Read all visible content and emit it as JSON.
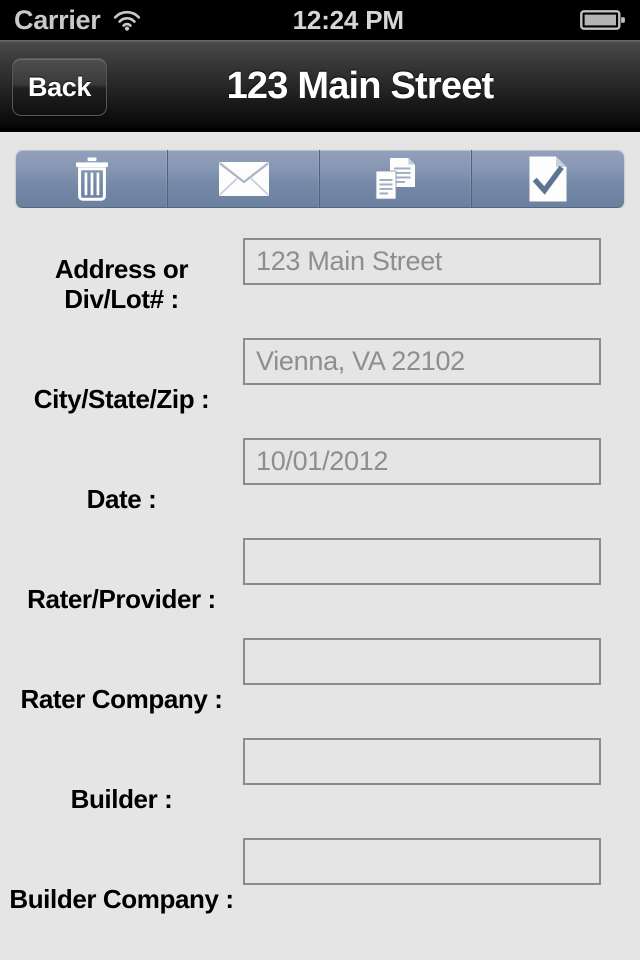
{
  "status_bar": {
    "carrier": "Carrier",
    "time": "12:24 PM",
    "wifi_icon": "wifi-icon",
    "battery_icon": "battery-icon"
  },
  "nav_bar": {
    "back_label": "Back",
    "title": "123 Main Street"
  },
  "toolbar": {
    "segments": [
      {
        "name": "delete-button",
        "icon": "trash-icon"
      },
      {
        "name": "email-button",
        "icon": "envelope-icon"
      },
      {
        "name": "duplicate-button",
        "icon": "copy-documents-icon"
      },
      {
        "name": "complete-button",
        "icon": "document-checkmark-icon"
      }
    ]
  },
  "form": {
    "fields": [
      {
        "label": "Address or\nDiv/Lot# :",
        "value": "123 Main Street",
        "placeholder": "123 Main Street"
      },
      {
        "label": "City/State/Zip :",
        "value": "Vienna, VA 22102",
        "placeholder": "Vienna, VA 22102"
      },
      {
        "label": "Date :",
        "value": "10/01/2012",
        "placeholder": "10/01/2012"
      },
      {
        "label": "Rater/Provider :",
        "value": "",
        "placeholder": ""
      },
      {
        "label": "Rater Company :",
        "value": "",
        "placeholder": ""
      },
      {
        "label": "Builder :",
        "value": "",
        "placeholder": ""
      },
      {
        "label": "Builder Company :",
        "value": "",
        "placeholder": ""
      }
    ]
  },
  "colors": {
    "page_background": "#e5e5e5",
    "toolbar_blue": "#8496b2",
    "field_border": "#8b8b8b",
    "field_text": "#8e8e8e",
    "status_bar": "#000000"
  }
}
